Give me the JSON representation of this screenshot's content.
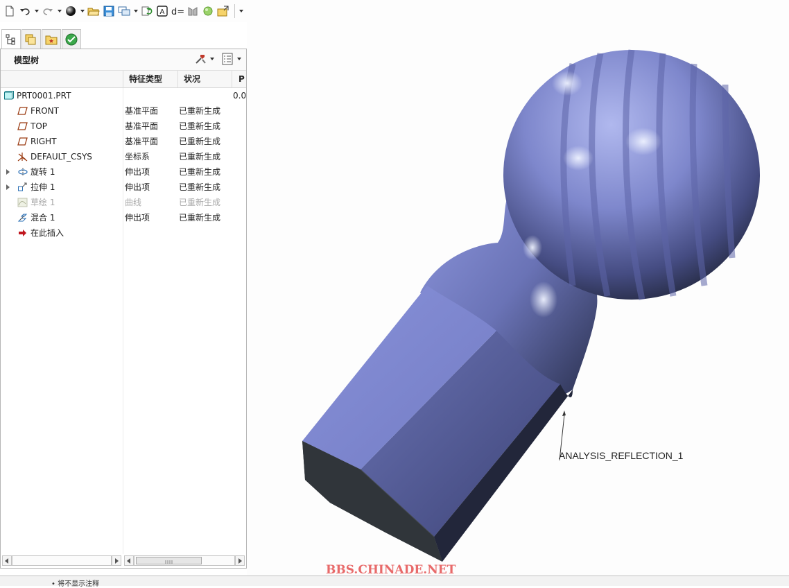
{
  "toolbar": {
    "icons": [
      "new-file-icon",
      "undo-icon",
      "redo-icon",
      "render-sphere-icon",
      "open-folder-icon",
      "save-icon",
      "window-icon",
      "regenerate-icon",
      "annotation-icon",
      "dimension-icon",
      "datum-plane-icon",
      "appearance-icon",
      "close-window-icon",
      "customize-icon"
    ]
  },
  "model_tree": {
    "title": "模型树",
    "columns": {
      "type": "特征类型",
      "status": "状况",
      "extra": "P"
    },
    "rows": [
      {
        "name": "PRT0001.PRT",
        "type": "",
        "status": "",
        "extra": "0.0",
        "icon": "part-icon"
      },
      {
        "name": "FRONT",
        "type": "基准平面",
        "status": "已重新生成",
        "icon": "datum-plane-icon"
      },
      {
        "name": "TOP",
        "type": "基准平面",
        "status": "已重新生成",
        "icon": "datum-plane-icon"
      },
      {
        "name": "RIGHT",
        "type": "基准平面",
        "status": "已重新生成",
        "icon": "datum-plane-icon"
      },
      {
        "name": "DEFAULT_CSYS",
        "type": "坐标系",
        "status": "已重新生成",
        "icon": "csys-icon"
      },
      {
        "name": "旋转 1",
        "type": "伸出项",
        "status": "已重新生成",
        "icon": "revolve-icon"
      },
      {
        "name": "拉伸 1",
        "type": "伸出项",
        "status": "已重新生成",
        "icon": "extrude-icon"
      },
      {
        "name": "草绘 1",
        "type": "曲线",
        "status": "已重新生成",
        "icon": "sketch-icon"
      },
      {
        "name": "混合 1",
        "type": "伸出项",
        "status": "已重新生成",
        "icon": "blend-icon"
      },
      {
        "name": "在此插入",
        "type": "",
        "status": "",
        "icon": "insert-here-icon"
      }
    ]
  },
  "graphics": {
    "annotation": "ANALYSIS_REFLECTION_1",
    "colors": {
      "body": "#7e87cc",
      "shadow": "#2e3446",
      "highlight": "#dfe6ff"
    }
  },
  "status_bar": {
    "message": "• 将不显示注释"
  },
  "watermark": "BBS.CHINADE.NET"
}
